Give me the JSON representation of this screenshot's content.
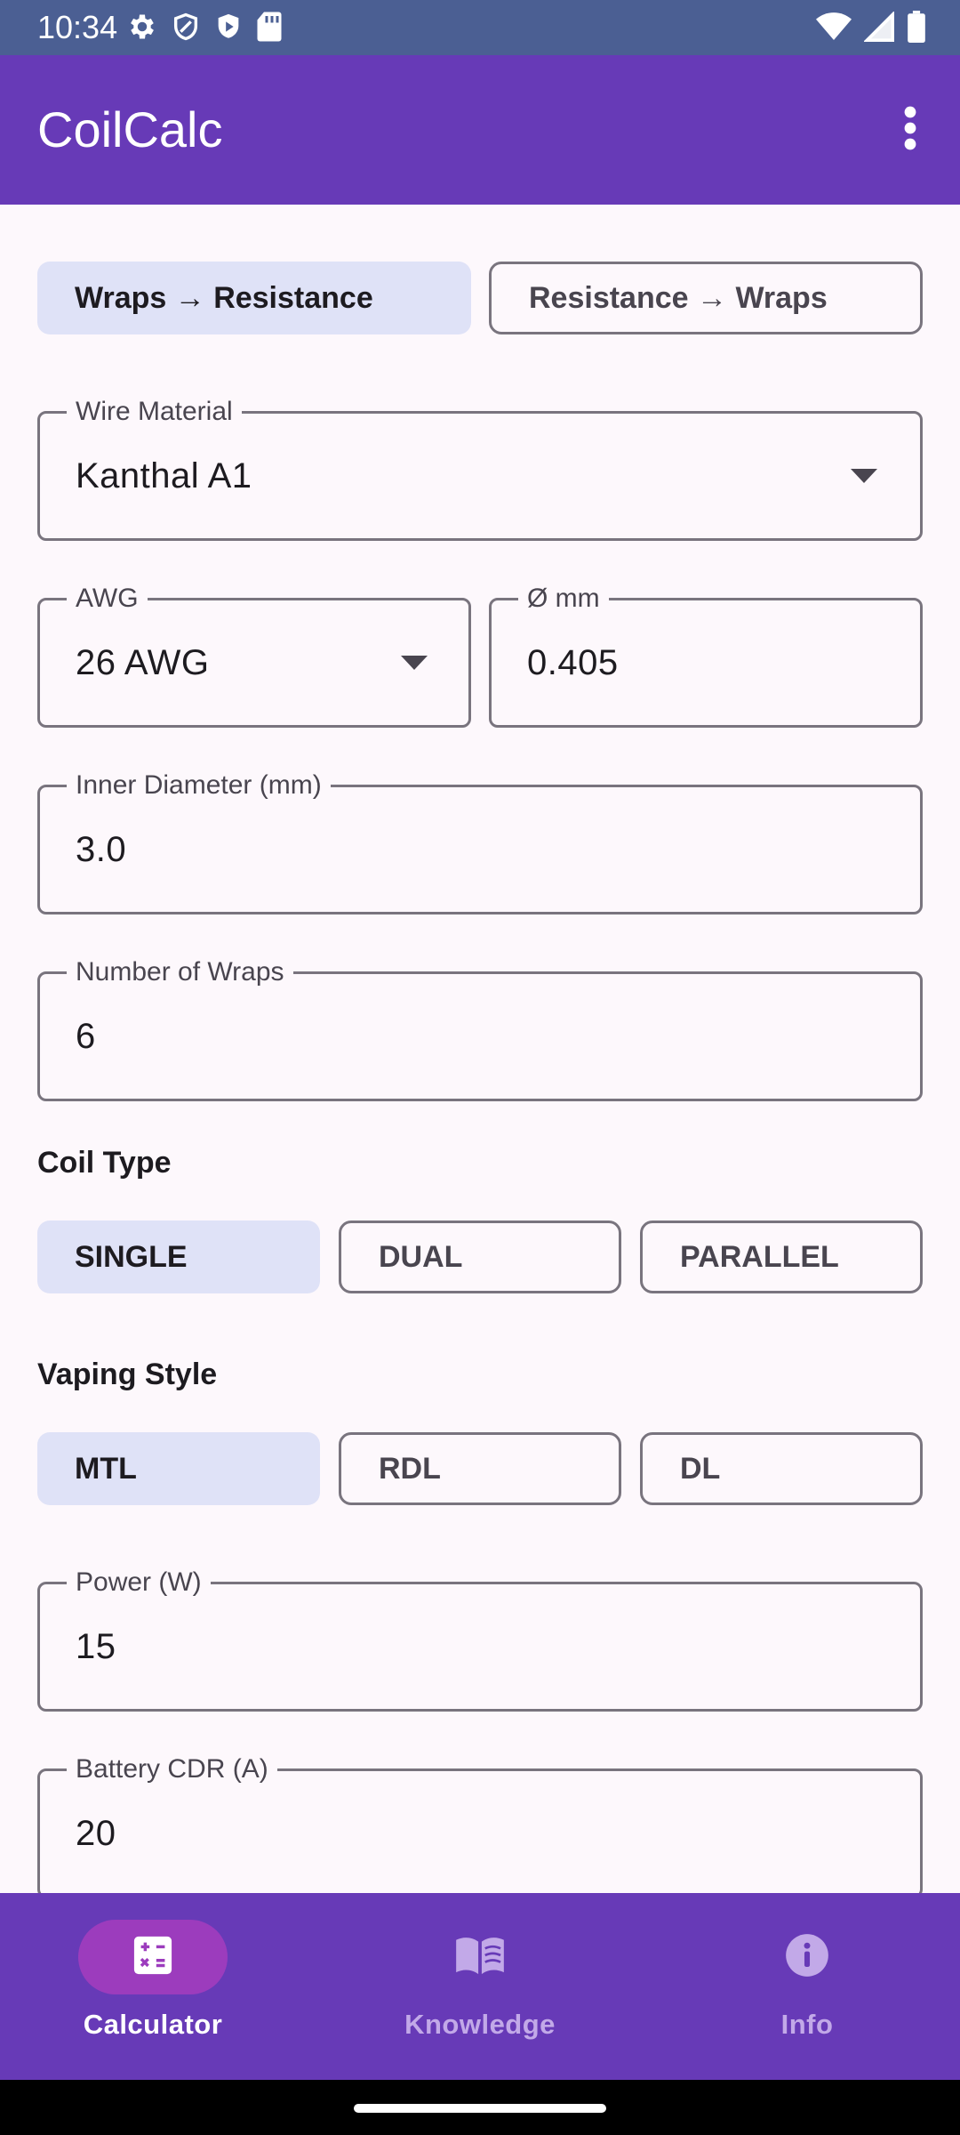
{
  "status_bar": {
    "time": "10:34",
    "left_icons": [
      "gear-icon",
      "shield-icon",
      "play-store-icon",
      "sd-card-icon"
    ],
    "right_icons": [
      "wifi-icon",
      "signal-icon",
      "battery-icon"
    ]
  },
  "app_bar": {
    "title": "CoilCalc",
    "menu_icon": "more-vert-icon"
  },
  "mode_toggle": {
    "options": [
      "Wraps → Resistance",
      "Resistance → Wraps"
    ],
    "selected": "Wraps → Resistance"
  },
  "form": {
    "wire_material": {
      "label": "Wire Material",
      "value": "Kanthal A1"
    },
    "awg": {
      "label": "AWG",
      "value": "26 AWG"
    },
    "diameter_mm": {
      "label": "Ø mm",
      "value": "0.405"
    },
    "inner_diameter": {
      "label": "Inner Diameter (mm)",
      "value": "3.0"
    },
    "number_of_wraps": {
      "label": "Number of Wraps",
      "value": "6"
    },
    "power": {
      "label": "Power (W)",
      "value": "15"
    },
    "battery_cdr": {
      "label": "Battery CDR (A)",
      "value": "20"
    }
  },
  "coil_type": {
    "title": "Coil Type",
    "options": [
      "SINGLE",
      "DUAL",
      "PARALLEL"
    ],
    "selected": "SINGLE"
  },
  "vaping_style": {
    "title": "Vaping Style",
    "options": [
      "MTL",
      "RDL",
      "DL"
    ],
    "selected": "MTL"
  },
  "bottom_nav": {
    "items": [
      {
        "label": "Calculator",
        "icon": "calculator-icon",
        "active": true
      },
      {
        "label": "Knowledge",
        "icon": "book-icon",
        "active": false
      },
      {
        "label": "Info",
        "icon": "info-icon",
        "active": false
      }
    ]
  },
  "colors": {
    "status_bar": "#4b5f93",
    "primary": "#673ab7",
    "selected_chip": "#dfe2f7",
    "active_nav_indicator": "#9c3cbd",
    "background": "#fdf8fc",
    "outline": "#79747e"
  }
}
